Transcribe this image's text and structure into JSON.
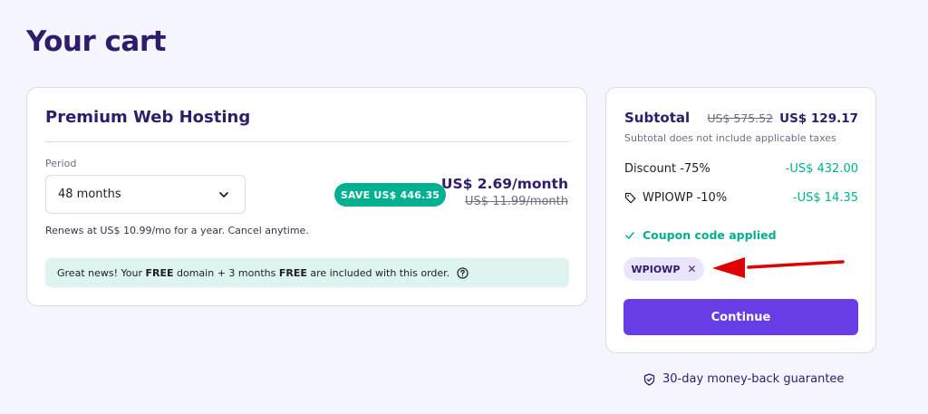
{
  "page": {
    "title": "Your cart"
  },
  "product": {
    "name": "Premium Web Hosting",
    "period_label": "Period",
    "period_value": "48 months",
    "save_badge": "SAVE US$ 446.35",
    "price": "US$ 2.69/month",
    "old_price": "US$ 11.99/month",
    "renew_note": "Renews at US$ 10.99/mo for a year. Cancel anytime.",
    "promo": {
      "part1": "Great news! Your ",
      "free1": "FREE",
      "part2": " domain + 3 months ",
      "free2": "FREE",
      "part3": " are included with this order."
    }
  },
  "summary": {
    "subtotal_label": "Subtotal",
    "subtotal_old": "US$ 575.52",
    "subtotal_new": "US$ 129.17",
    "tax_note": "Subtotal does not include applicable taxes",
    "discount_label": "Discount -75%",
    "discount_value": "-US$ 432.00",
    "coupon_label": "WPIOWP -10%",
    "coupon_value": "-US$ 14.35",
    "coupon_applied": "Coupon code applied",
    "coupon_chip": "WPIOWP",
    "continue_label": "Continue"
  },
  "guarantee": "30-day money-back guarantee",
  "icons": {
    "period_dropdown": "chevron-down-icon",
    "promo_help": "question-circle-icon",
    "coupon": "tag-icon",
    "applied": "check-icon",
    "chip_remove": "close-icon",
    "guarantee": "shield-check-icon",
    "annotation": "red-arrow"
  },
  "colors": {
    "primary": "#673de6",
    "success": "#00b090",
    "heading": "#2f1c6a",
    "background": "#f4f5ff",
    "arrow": "#e00000"
  }
}
